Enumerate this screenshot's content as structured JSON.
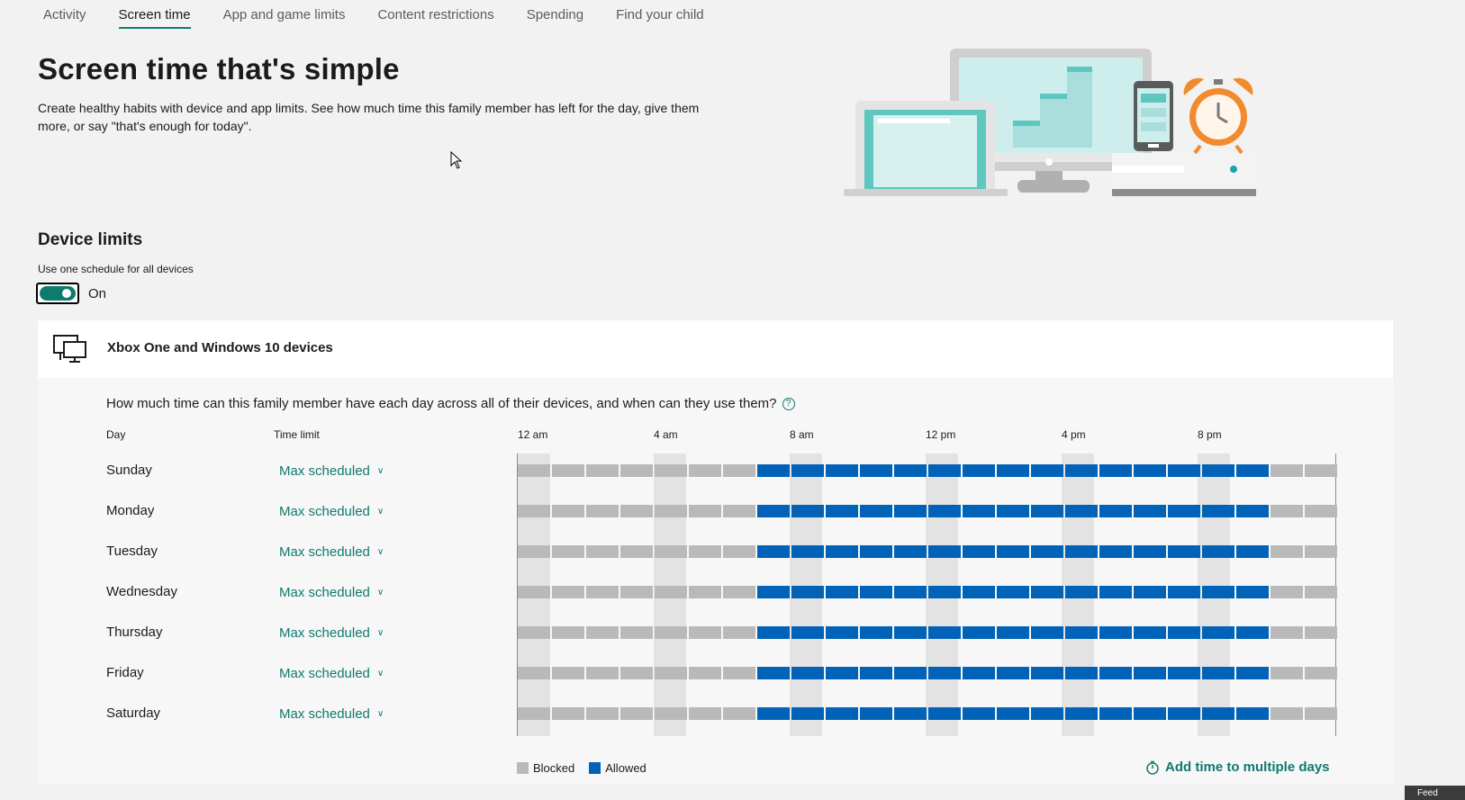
{
  "nav": {
    "tabs": [
      "Activity",
      "Screen time",
      "App and game limits",
      "Content restrictions",
      "Spending",
      "Find your child"
    ],
    "active": "Screen time"
  },
  "hero": {
    "title": "Screen time that's simple",
    "description": "Create healthy habits with device and app limits. See how much time this family member has left for the day, give them more, or say \"that's enough for today\"."
  },
  "device_limits": {
    "title": "Device limits",
    "toggle_label": "Use one schedule for all devices",
    "toggle_state": "On",
    "toggle_on": true
  },
  "card": {
    "title": "Xbox One and Windows 10 devices",
    "question": "How much time can this family member have each day across all of their devices, and when can they use them?",
    "col_day": "Day",
    "col_time_limit": "Time limit",
    "hour_labels": [
      "12 am",
      "4 am",
      "8 am",
      "12 pm",
      "4 pm",
      "8 pm"
    ],
    "days": [
      {
        "name": "Sunday",
        "limit": "Max scheduled"
      },
      {
        "name": "Monday",
        "limit": "Max scheduled"
      },
      {
        "name": "Tuesday",
        "limit": "Max scheduled"
      },
      {
        "name": "Wednesday",
        "limit": "Max scheduled"
      },
      {
        "name": "Thursday",
        "limit": "Max scheduled"
      },
      {
        "name": "Friday",
        "limit": "Max scheduled"
      },
      {
        "name": "Saturday",
        "limit": "Max scheduled"
      }
    ],
    "schedule": {
      "segments_per_day": 24,
      "allowed_from_hour": 7,
      "allowed_to_hour": 22
    },
    "legend": {
      "blocked": "Blocked",
      "allowed": "Allowed"
    },
    "add_time_label": "Add time to multiple days"
  },
  "colors": {
    "accent": "#0f7a6f",
    "allowed": "#0063b8",
    "blocked": "#b9b9b9"
  },
  "feedback_label": "Feed"
}
